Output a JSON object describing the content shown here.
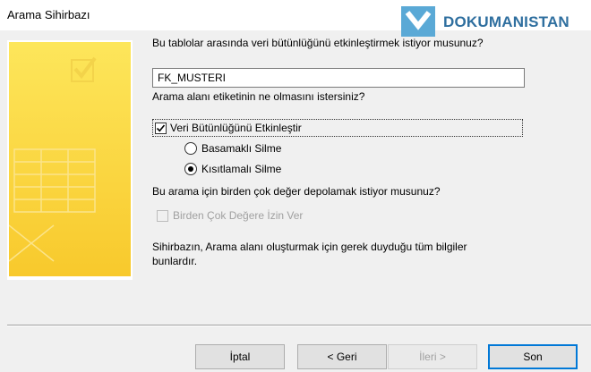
{
  "window": {
    "title": "Arama Sihirbazı"
  },
  "watermark": {
    "text": "DOKUMANISTAN"
  },
  "questions": {
    "q1": "Bu tablolar arasında veri bütünlüğünü etkinleştirmek istiyor musunuz?",
    "field_name_value": "FK_MUSTERI",
    "q2": "Arama alanı etiketinin ne olmasını istersiniz?",
    "q3": "Bu arama için birden çok değer depolamak istiyor musunuz?"
  },
  "integrity": {
    "checkbox_label": "Veri Bütünlüğünü Etkinleştir",
    "checked": true,
    "options": [
      {
        "label": "Basamaklı Silme",
        "selected": false
      },
      {
        "label": "Kısıtlamalı Silme",
        "selected": true
      }
    ]
  },
  "multi_value": {
    "label": "Birden Çok Değere İzin Ver",
    "checked": false,
    "enabled": false
  },
  "info": "Sihirbazın, Arama alanı oluşturmak için gerek duyduğu tüm bilgiler bunlardır.",
  "buttons": {
    "cancel": "İptal",
    "back": "< Geri",
    "next": "İleri >",
    "finish": "Son"
  }
}
